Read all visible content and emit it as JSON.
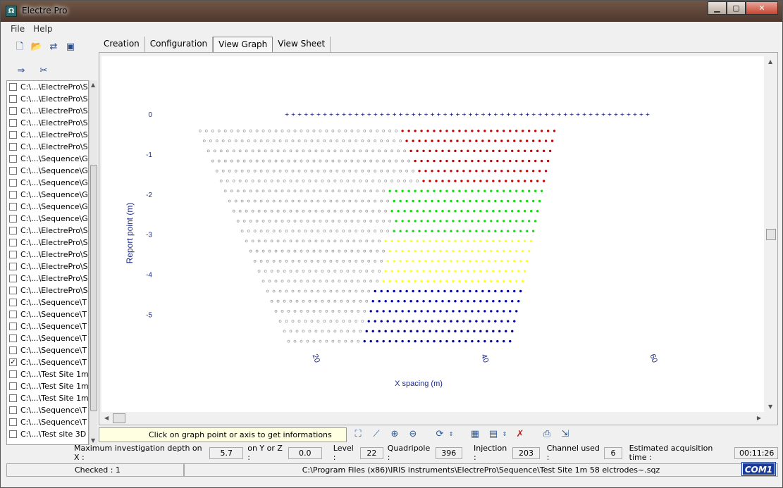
{
  "window": {
    "title": "Electre Pro"
  },
  "menu": [
    "File",
    "Help"
  ],
  "tabs": [
    "Creation",
    "Configuration",
    "View Graph",
    "View Sheet"
  ],
  "active_tab": "View Graph",
  "files": [
    {
      "label": "C:\\...\\ElectrePro\\S",
      "checked": false
    },
    {
      "label": "C:\\...\\ElectrePro\\S",
      "checked": false
    },
    {
      "label": "C:\\...\\ElectrePro\\S",
      "checked": false
    },
    {
      "label": "C:\\...\\ElectrePro\\S",
      "checked": false
    },
    {
      "label": "C:\\...\\ElectrePro\\S",
      "checked": false
    },
    {
      "label": "C:\\...\\ElectrePro\\S",
      "checked": false
    },
    {
      "label": "C:\\...\\Sequence\\G",
      "checked": false
    },
    {
      "label": "C:\\...\\Sequence\\G",
      "checked": false
    },
    {
      "label": "C:\\...\\Sequence\\G",
      "checked": false
    },
    {
      "label": "C:\\...\\Sequence\\G",
      "checked": false
    },
    {
      "label": "C:\\...\\Sequence\\G",
      "checked": false
    },
    {
      "label": "C:\\...\\Sequence\\G",
      "checked": false
    },
    {
      "label": "C:\\...\\ElectrePro\\S",
      "checked": false
    },
    {
      "label": "C:\\...\\ElectrePro\\S",
      "checked": false
    },
    {
      "label": "C:\\...\\ElectrePro\\S",
      "checked": false
    },
    {
      "label": "C:\\...\\ElectrePro\\S",
      "checked": false
    },
    {
      "label": "C:\\...\\ElectrePro\\S",
      "checked": false
    },
    {
      "label": "C:\\...\\ElectrePro\\S",
      "checked": false
    },
    {
      "label": "C:\\...\\Sequence\\T",
      "checked": false
    },
    {
      "label": "C:\\...\\Sequence\\T",
      "checked": false
    },
    {
      "label": "C:\\...\\Sequence\\T",
      "checked": false
    },
    {
      "label": "C:\\...\\Sequence\\T",
      "checked": false
    },
    {
      "label": "C:\\...\\Sequence\\T",
      "checked": false
    },
    {
      "label": "C:\\...\\Sequence\\T",
      "checked": true
    },
    {
      "label": "C:\\...\\Test Site 1m",
      "checked": false
    },
    {
      "label": "C:\\...\\Test Site 1m",
      "checked": false
    },
    {
      "label": "C:\\...\\Test Site 1m",
      "checked": false
    },
    {
      "label": "C:\\...\\Sequence\\T",
      "checked": false
    },
    {
      "label": "C:\\...\\Sequence\\T",
      "checked": false
    },
    {
      "label": "C:\\...\\Test site 3D",
      "checked": false
    }
  ],
  "graph": {
    "ylabel": "Report point (m)",
    "xlabel": "X spacing (m)",
    "y_ticks": [
      "0",
      "-1",
      "-2",
      "-3",
      "-4",
      "-5"
    ],
    "x_ticks": [
      "20",
      "40",
      "60"
    ]
  },
  "chart_data": {
    "type": "scatter",
    "title": "",
    "xlabel": "X spacing (m)",
    "ylabel": "Report point (m)",
    "xlim": [
      0,
      70
    ],
    "ylim": [
      -5.8,
      0
    ],
    "electrodes": {
      "count": 58,
      "y": 0,
      "x_start": 16.8,
      "x_step": 0.75
    },
    "rows": {
      "count": 22,
      "y_start": -0.42,
      "y_step": -0.25,
      "first_x_start": 6.5,
      "x_start_step": 0.5,
      "pitch": 0.75,
      "first_count": 57,
      "count_step": -1
    },
    "bands": [
      {
        "rows": [
          0,
          5
        ],
        "color": "#cc0000",
        "tail_counts": [
          25,
          24,
          23,
          22,
          21,
          20
        ]
      },
      {
        "rows": [
          6,
          10
        ],
        "color": "#11dd11",
        "tail_counts": [
          25,
          24,
          24,
          23,
          23
        ]
      },
      {
        "rows": [
          11,
          15
        ],
        "color": "#ffff22",
        "tail_counts": [
          24,
          23,
          23,
          23,
          23
        ]
      },
      {
        "rows": [
          16,
          21
        ],
        "color": "#0000aa",
        "tail_counts": [
          24,
          24,
          24,
          24,
          24,
          24
        ]
      }
    ],
    "grey_color": "#a0a0a0",
    "electrode_color": "#000066"
  },
  "info_text": "Click on graph point or axis to get informations",
  "status": {
    "max_depth_label": "Maximum investigation depth on X :",
    "max_depth_value": "5.7",
    "yz_label": "on Y or Z :",
    "yz_value": "0.0",
    "level_label": "Level :",
    "level_value": "22",
    "quadripole_label": "Quadripole :",
    "quadripole_value": "396",
    "injection_label": "Injection :",
    "injection_value": "203",
    "channel_label": "Channel used :",
    "channel_value": "6",
    "time_label": "Estimated acquisition time :",
    "time_value": "00:11:26"
  },
  "footer": {
    "checked": "Checked : 1",
    "path": "C:\\Program Files (x86)\\IRIS instruments\\ElectrePro\\Sequence\\Test Site 1m 58 elctrodes~.sqz",
    "badge": "COM1"
  }
}
